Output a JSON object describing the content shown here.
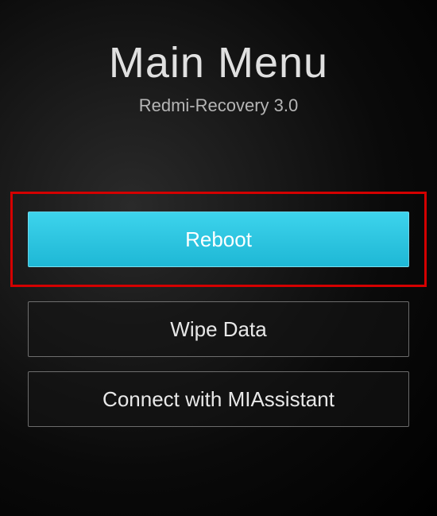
{
  "header": {
    "title": "Main Menu",
    "subtitle": "Redmi-Recovery 3.0"
  },
  "menu": {
    "items": [
      {
        "label": "Reboot",
        "selected": true,
        "highlighted": true
      },
      {
        "label": "Wipe Data",
        "selected": false,
        "highlighted": false
      },
      {
        "label": "Connect with MIAssistant",
        "selected": false,
        "highlighted": false
      }
    ]
  }
}
